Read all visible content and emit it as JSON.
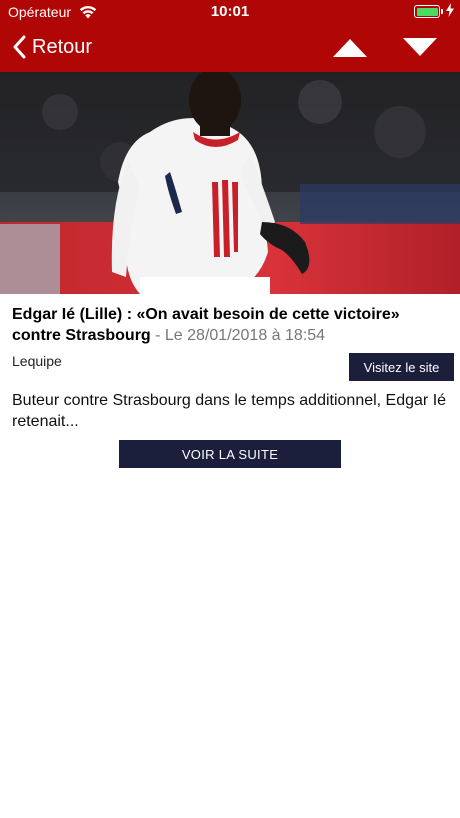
{
  "status_bar": {
    "carrier": "Opérateur",
    "time": "10:01",
    "wifi_icon": "wifi-icon",
    "battery_icon": "battery-icon",
    "charging_icon": "charging-bolt-icon"
  },
  "nav": {
    "back_label": "Retour",
    "back_icon": "chevron-left-icon",
    "up_icon": "triangle-up-icon",
    "down_icon": "triangle-down-icon",
    "background_color": "#b10606"
  },
  "article": {
    "title": "Edgar Ié (Lille) : «On avait besoin de cette victoire» contre Strasbourg",
    "date": " - Le 28/01/2018 à 18:54",
    "source": "Lequipe",
    "visit_label": "Visitez le site",
    "summary": "Buteur contre Strasbourg dans le temps additionnel, Edgar Ié retenait...",
    "more_label": "VOIR LA SUITE"
  },
  "colors": {
    "button_bg": "#1b1f3b",
    "battery_fill": "#4cd964",
    "date_text": "#777777"
  }
}
